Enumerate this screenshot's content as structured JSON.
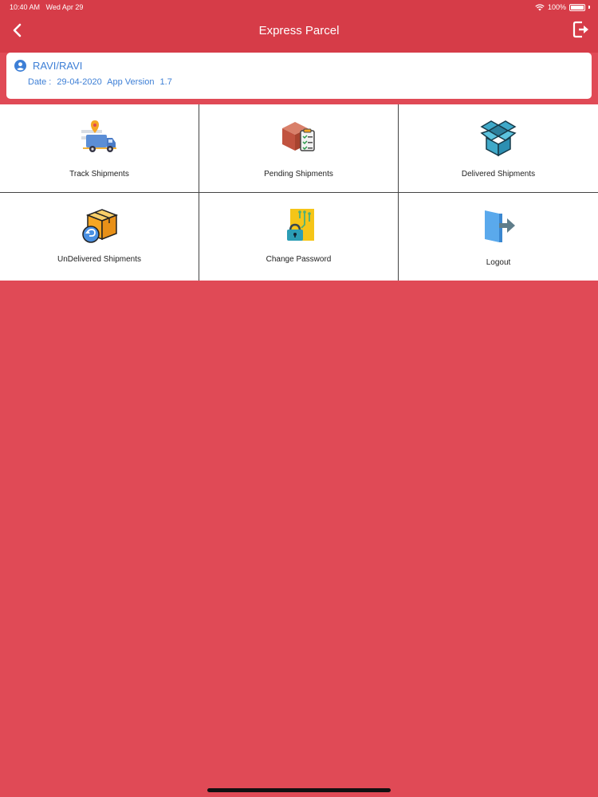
{
  "status": {
    "time": "10:40 AM",
    "date": "Wed Apr 29",
    "battery": "100%"
  },
  "header": {
    "title": "Express Parcel",
    "back_icon": "chevron-left-icon",
    "logout_icon": "logout-icon"
  },
  "user": {
    "name": "RAVI/RAVI",
    "date_label": "Date :",
    "date_value": "29-04-2020",
    "version_label": "App Version",
    "version_value": "1.7"
  },
  "menu": [
    {
      "label": "Track Shipments",
      "icon": "delivery-truck-icon"
    },
    {
      "label": "Pending Shipments",
      "icon": "box-checklist-icon"
    },
    {
      "label": "Delivered Shipments",
      "icon": "open-box-icon"
    },
    {
      "label": "UnDelivered Shipments",
      "icon": "box-return-icon"
    },
    {
      "label": "Change Password",
      "icon": "lock-circuit-icon"
    },
    {
      "label": "Logout",
      "icon": "door-exit-icon"
    }
  ],
  "colors": {
    "header": "#d63c48",
    "background": "#e04a56",
    "accent_text": "#3d7fd6"
  }
}
